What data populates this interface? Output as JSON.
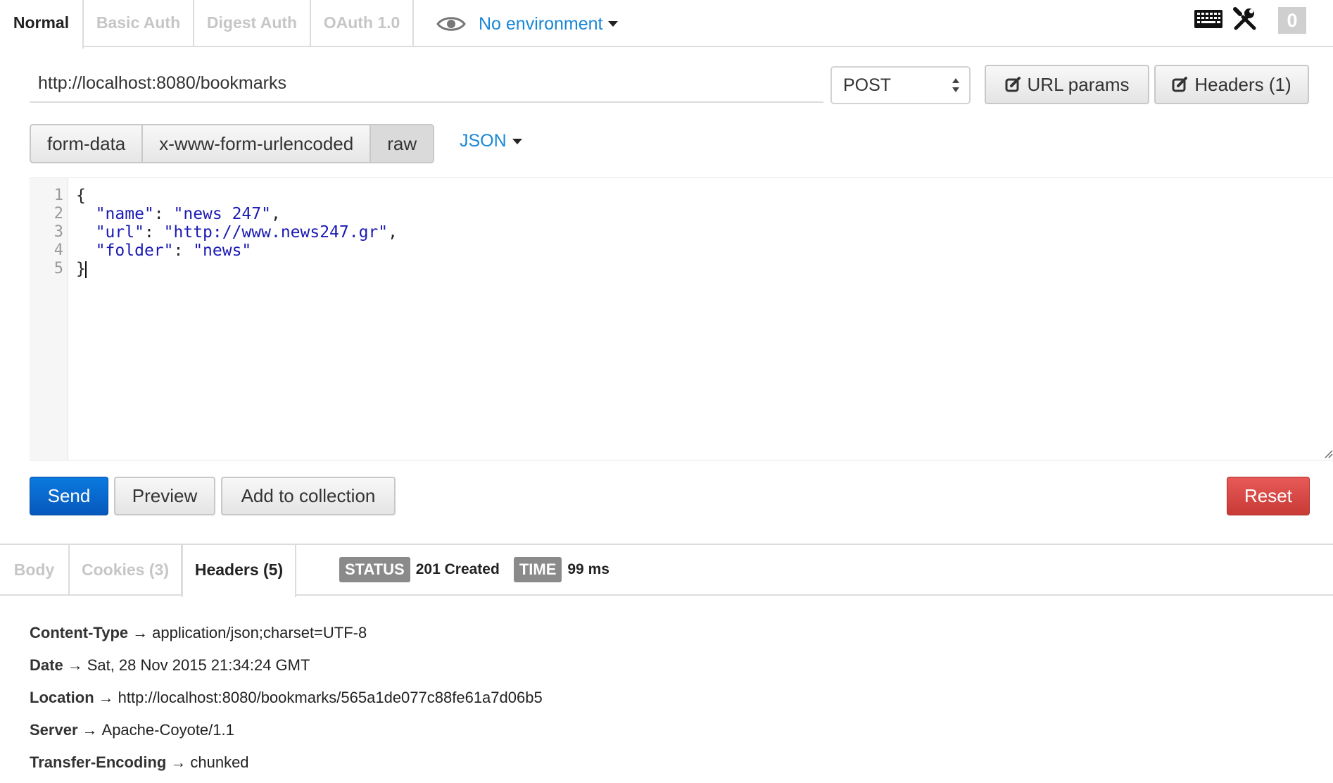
{
  "auth_tabs": [
    {
      "label": "Normal",
      "active": true
    },
    {
      "label": "Basic Auth",
      "active": false
    },
    {
      "label": "Digest Auth",
      "active": false
    },
    {
      "label": "OAuth 1.0",
      "active": false
    }
  ],
  "environment": {
    "label": "No environment",
    "icon": "eye-icon"
  },
  "toolbar_right": {
    "keyboard_icon": "keyboard-icon",
    "tools_icon": "tools-icon",
    "counter": "0"
  },
  "request": {
    "url": "http://localhost:8080/bookmarks",
    "method": "POST",
    "url_params_label": "URL params",
    "headers_label": "Headers (1)"
  },
  "body_types": [
    {
      "label": "form-data",
      "active": false
    },
    {
      "label": "x-www-form-urlencoded",
      "active": false
    },
    {
      "label": "raw",
      "active": true
    }
  ],
  "raw_format": "JSON",
  "editor": {
    "line_numbers": [
      "1",
      "2",
      "3",
      "4",
      "5"
    ],
    "lines": [
      {
        "pre": "{",
        "key": "",
        "mid": "",
        "val": "",
        "post": ""
      },
      {
        "pre": "  ",
        "key": "\"name\"",
        "mid": ": ",
        "val": "\"news 247\"",
        "post": ","
      },
      {
        "pre": "  ",
        "key": "\"url\"",
        "mid": ": ",
        "val": "\"http://www.news247.gr\"",
        "post": ","
      },
      {
        "pre": "  ",
        "key": "\"folder\"",
        "mid": ": ",
        "val": "\"news\"",
        "post": ""
      },
      {
        "pre": "}",
        "key": "",
        "mid": "",
        "val": "",
        "post": ""
      }
    ]
  },
  "actions": {
    "send": "Send",
    "preview": "Preview",
    "add_to_collection": "Add to collection",
    "reset": "Reset"
  },
  "response_tabs": [
    {
      "label": "Body",
      "active": false
    },
    {
      "label": "Cookies (3)",
      "active": false
    },
    {
      "label": "Headers (5)",
      "active": true
    }
  ],
  "status": {
    "status_label": "STATUS",
    "status_value": "201 Created",
    "time_label": "TIME",
    "time_value": "99 ms"
  },
  "arrow": "→",
  "response_headers": [
    {
      "key": "Content-Type",
      "value": "application/json;charset=UTF-8"
    },
    {
      "key": "Date",
      "value": "Sat, 28 Nov 2015 21:34:24 GMT"
    },
    {
      "key": "Location",
      "value": "http://localhost:8080/bookmarks/565a1de077c88fe61a7d06b5"
    },
    {
      "key": "Server",
      "value": "Apache-Coyote/1.1"
    },
    {
      "key": "Transfer-Encoding",
      "value": "chunked"
    }
  ],
  "colors": {
    "accent_blue": "#1a87d7",
    "send_blue": "#0a6fd6",
    "reset_red": "#d9463f",
    "string_blue": "#1a1ab4"
  }
}
